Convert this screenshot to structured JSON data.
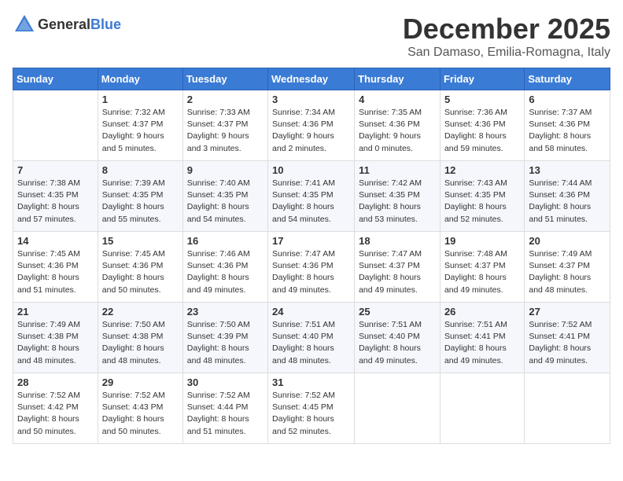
{
  "header": {
    "logo_general": "General",
    "logo_blue": "Blue",
    "month_title": "December 2025",
    "location": "San Damaso, Emilia-Romagna, Italy"
  },
  "days_of_week": [
    "Sunday",
    "Monday",
    "Tuesday",
    "Wednesday",
    "Thursday",
    "Friday",
    "Saturday"
  ],
  "weeks": [
    [
      {
        "day": "",
        "sunrise": "",
        "sunset": "",
        "daylight": ""
      },
      {
        "day": "1",
        "sunrise": "Sunrise: 7:32 AM",
        "sunset": "Sunset: 4:37 PM",
        "daylight": "Daylight: 9 hours and 5 minutes."
      },
      {
        "day": "2",
        "sunrise": "Sunrise: 7:33 AM",
        "sunset": "Sunset: 4:37 PM",
        "daylight": "Daylight: 9 hours and 3 minutes."
      },
      {
        "day": "3",
        "sunrise": "Sunrise: 7:34 AM",
        "sunset": "Sunset: 4:36 PM",
        "daylight": "Daylight: 9 hours and 2 minutes."
      },
      {
        "day": "4",
        "sunrise": "Sunrise: 7:35 AM",
        "sunset": "Sunset: 4:36 PM",
        "daylight": "Daylight: 9 hours and 0 minutes."
      },
      {
        "day": "5",
        "sunrise": "Sunrise: 7:36 AM",
        "sunset": "Sunset: 4:36 PM",
        "daylight": "Daylight: 8 hours and 59 minutes."
      },
      {
        "day": "6",
        "sunrise": "Sunrise: 7:37 AM",
        "sunset": "Sunset: 4:36 PM",
        "daylight": "Daylight: 8 hours and 58 minutes."
      }
    ],
    [
      {
        "day": "7",
        "sunrise": "Sunrise: 7:38 AM",
        "sunset": "Sunset: 4:35 PM",
        "daylight": "Daylight: 8 hours and 57 minutes."
      },
      {
        "day": "8",
        "sunrise": "Sunrise: 7:39 AM",
        "sunset": "Sunset: 4:35 PM",
        "daylight": "Daylight: 8 hours and 55 minutes."
      },
      {
        "day": "9",
        "sunrise": "Sunrise: 7:40 AM",
        "sunset": "Sunset: 4:35 PM",
        "daylight": "Daylight: 8 hours and 54 minutes."
      },
      {
        "day": "10",
        "sunrise": "Sunrise: 7:41 AM",
        "sunset": "Sunset: 4:35 PM",
        "daylight": "Daylight: 8 hours and 54 minutes."
      },
      {
        "day": "11",
        "sunrise": "Sunrise: 7:42 AM",
        "sunset": "Sunset: 4:35 PM",
        "daylight": "Daylight: 8 hours and 53 minutes."
      },
      {
        "day": "12",
        "sunrise": "Sunrise: 7:43 AM",
        "sunset": "Sunset: 4:35 PM",
        "daylight": "Daylight: 8 hours and 52 minutes."
      },
      {
        "day": "13",
        "sunrise": "Sunrise: 7:44 AM",
        "sunset": "Sunset: 4:36 PM",
        "daylight": "Daylight: 8 hours and 51 minutes."
      }
    ],
    [
      {
        "day": "14",
        "sunrise": "Sunrise: 7:45 AM",
        "sunset": "Sunset: 4:36 PM",
        "daylight": "Daylight: 8 hours and 51 minutes."
      },
      {
        "day": "15",
        "sunrise": "Sunrise: 7:45 AM",
        "sunset": "Sunset: 4:36 PM",
        "daylight": "Daylight: 8 hours and 50 minutes."
      },
      {
        "day": "16",
        "sunrise": "Sunrise: 7:46 AM",
        "sunset": "Sunset: 4:36 PM",
        "daylight": "Daylight: 8 hours and 49 minutes."
      },
      {
        "day": "17",
        "sunrise": "Sunrise: 7:47 AM",
        "sunset": "Sunset: 4:36 PM",
        "daylight": "Daylight: 8 hours and 49 minutes."
      },
      {
        "day": "18",
        "sunrise": "Sunrise: 7:47 AM",
        "sunset": "Sunset: 4:37 PM",
        "daylight": "Daylight: 8 hours and 49 minutes."
      },
      {
        "day": "19",
        "sunrise": "Sunrise: 7:48 AM",
        "sunset": "Sunset: 4:37 PM",
        "daylight": "Daylight: 8 hours and 49 minutes."
      },
      {
        "day": "20",
        "sunrise": "Sunrise: 7:49 AM",
        "sunset": "Sunset: 4:37 PM",
        "daylight": "Daylight: 8 hours and 48 minutes."
      }
    ],
    [
      {
        "day": "21",
        "sunrise": "Sunrise: 7:49 AM",
        "sunset": "Sunset: 4:38 PM",
        "daylight": "Daylight: 8 hours and 48 minutes."
      },
      {
        "day": "22",
        "sunrise": "Sunrise: 7:50 AM",
        "sunset": "Sunset: 4:38 PM",
        "daylight": "Daylight: 8 hours and 48 minutes."
      },
      {
        "day": "23",
        "sunrise": "Sunrise: 7:50 AM",
        "sunset": "Sunset: 4:39 PM",
        "daylight": "Daylight: 8 hours and 48 minutes."
      },
      {
        "day": "24",
        "sunrise": "Sunrise: 7:51 AM",
        "sunset": "Sunset: 4:40 PM",
        "daylight": "Daylight: 8 hours and 48 minutes."
      },
      {
        "day": "25",
        "sunrise": "Sunrise: 7:51 AM",
        "sunset": "Sunset: 4:40 PM",
        "daylight": "Daylight: 8 hours and 49 minutes."
      },
      {
        "day": "26",
        "sunrise": "Sunrise: 7:51 AM",
        "sunset": "Sunset: 4:41 PM",
        "daylight": "Daylight: 8 hours and 49 minutes."
      },
      {
        "day": "27",
        "sunrise": "Sunrise: 7:52 AM",
        "sunset": "Sunset: 4:41 PM",
        "daylight": "Daylight: 8 hours and 49 minutes."
      }
    ],
    [
      {
        "day": "28",
        "sunrise": "Sunrise: 7:52 AM",
        "sunset": "Sunset: 4:42 PM",
        "daylight": "Daylight: 8 hours and 50 minutes."
      },
      {
        "day": "29",
        "sunrise": "Sunrise: 7:52 AM",
        "sunset": "Sunset: 4:43 PM",
        "daylight": "Daylight: 8 hours and 50 minutes."
      },
      {
        "day": "30",
        "sunrise": "Sunrise: 7:52 AM",
        "sunset": "Sunset: 4:44 PM",
        "daylight": "Daylight: 8 hours and 51 minutes."
      },
      {
        "day": "31",
        "sunrise": "Sunrise: 7:52 AM",
        "sunset": "Sunset: 4:45 PM",
        "daylight": "Daylight: 8 hours and 52 minutes."
      },
      {
        "day": "",
        "sunrise": "",
        "sunset": "",
        "daylight": ""
      },
      {
        "day": "",
        "sunrise": "",
        "sunset": "",
        "daylight": ""
      },
      {
        "day": "",
        "sunrise": "",
        "sunset": "",
        "daylight": ""
      }
    ]
  ]
}
